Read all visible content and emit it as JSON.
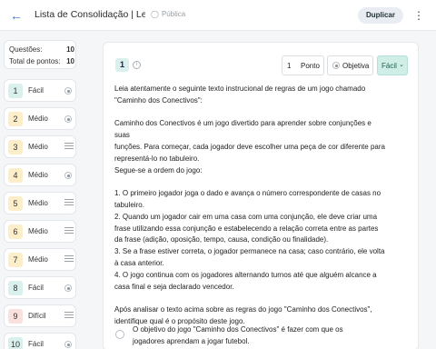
{
  "header": {
    "title": "Lista de Consolidação | Leit...",
    "visibility": "Pública",
    "duplicate_label": "Duplicar"
  },
  "stats": {
    "questions_label": "Questões:",
    "questions_value": "10",
    "points_label": "Total de pontos:",
    "points_value": "10"
  },
  "questions": [
    {
      "number": "1",
      "level": "Fácil",
      "type_icon": "radio-icon"
    },
    {
      "number": "2",
      "level": "Médio",
      "type_icon": "radio-icon"
    },
    {
      "number": "3",
      "level": "Médio",
      "type_icon": "lines-icon"
    },
    {
      "number": "4",
      "level": "Médio",
      "type_icon": "radio-icon"
    },
    {
      "number": "5",
      "level": "Médio",
      "type_icon": "lines-icon"
    },
    {
      "number": "6",
      "level": "Médio",
      "type_icon": "lines-icon"
    },
    {
      "number": "7",
      "level": "Médio",
      "type_icon": "lines-icon"
    },
    {
      "number": "8",
      "level": "Fácil",
      "type_icon": "radio-icon"
    },
    {
      "number": "9",
      "level": "Difícil",
      "type_icon": "lines-icon"
    },
    {
      "number": "10",
      "level": "Fácil",
      "type_icon": "radio-icon"
    }
  ],
  "editor": {
    "number": "1",
    "points_value": "1",
    "points_label": "Ponto",
    "type_label": "Objetiva",
    "level_label": "Fácil",
    "text_lines": [
      "Leia atentamente o seguinte texto instrucional de regras de um jogo chamado",
      "\"Caminho dos Conectivos\":",
      "",
      "Caminho dos Conectivos é um jogo divertido para aprender sobre conjunções e suas",
      "funções. Para começar, cada jogador deve escolher uma peça de cor diferente para",
      "representá-lo no tabuleiro.",
      "Segue-se a ordem do jogo:",
      "",
      "1. O primeiro jogador joga o dado e avança o número correspondente de casas no",
      "tabuleiro.",
      "2. Quando um jogador cair em uma casa com uma conjunção, ele deve criar uma",
      "frase utilizando essa conjunção e estabelecendo a relação correta entre as partes",
      "da frase (adição, oposição, tempo, causa, condição ou finalidade).",
      "3. Se a frase estiver correta, o jogador permanece na casa; caso contrário, ele volta",
      "à casa anterior.",
      "4. O jogo continua com os jogadores alternando turnos até que alguém alcance a",
      "casa final e seja declarado vencedor.",
      "",
      "Após analisar o texto acima sobre as regras do jogo \"Caminho dos Conectivos\",",
      "identifique qual é o propósito deste jogo."
    ],
    "option_1": "O objetivo do jogo \"Caminho dos Conectivos\" é fazer com que os jogadores aprendam a jogar futebol."
  },
  "colors": {
    "accent": "#2b6fd6",
    "easy": "#d9f0ec",
    "medium": "#fbeec9",
    "hard": "#fbe1de"
  }
}
